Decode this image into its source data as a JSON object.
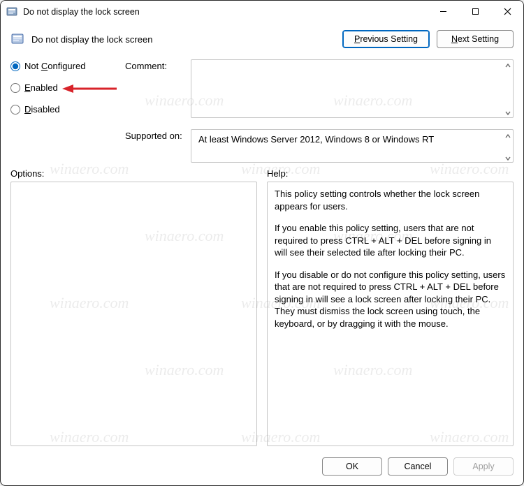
{
  "window": {
    "title": "Do not display the lock screen"
  },
  "policy": {
    "name": "Do not display the lock screen"
  },
  "nav": {
    "prev": "Previous Setting",
    "next": "Next Setting",
    "prev_mnemonic": "P",
    "next_mnemonic": "N"
  },
  "state": {
    "options": [
      {
        "id": "not_configured",
        "label": "Not Configured",
        "mnemonic": "C",
        "checked": true
      },
      {
        "id": "enabled",
        "label": "Enabled",
        "mnemonic": "E",
        "checked": false
      },
      {
        "id": "disabled",
        "label": "Disabled",
        "mnemonic": "D",
        "checked": false
      }
    ]
  },
  "labels": {
    "comment": "Comment:",
    "supported_on": "Supported on:",
    "options": "Options:",
    "help": "Help:"
  },
  "comment": "",
  "supported_on": "At least Windows Server 2012, Windows 8 or Windows RT",
  "help_paragraphs": [
    "This policy setting controls whether the lock screen appears for users.",
    "If you enable this policy setting, users that are not required to press CTRL + ALT + DEL before signing in will see their selected tile after locking their PC.",
    "If you disable or do not configure this policy setting, users that are not required to press CTRL + ALT + DEL before signing in will see a lock screen after locking their PC. They must dismiss the lock screen using touch, the keyboard, or by dragging it with the mouse."
  ],
  "footer": {
    "ok": "OK",
    "cancel": "Cancel",
    "apply": "Apply"
  },
  "watermark_text": "winaero.com",
  "annotation": {
    "arrow_target": "enabled",
    "arrow_color": "#d8232a"
  }
}
